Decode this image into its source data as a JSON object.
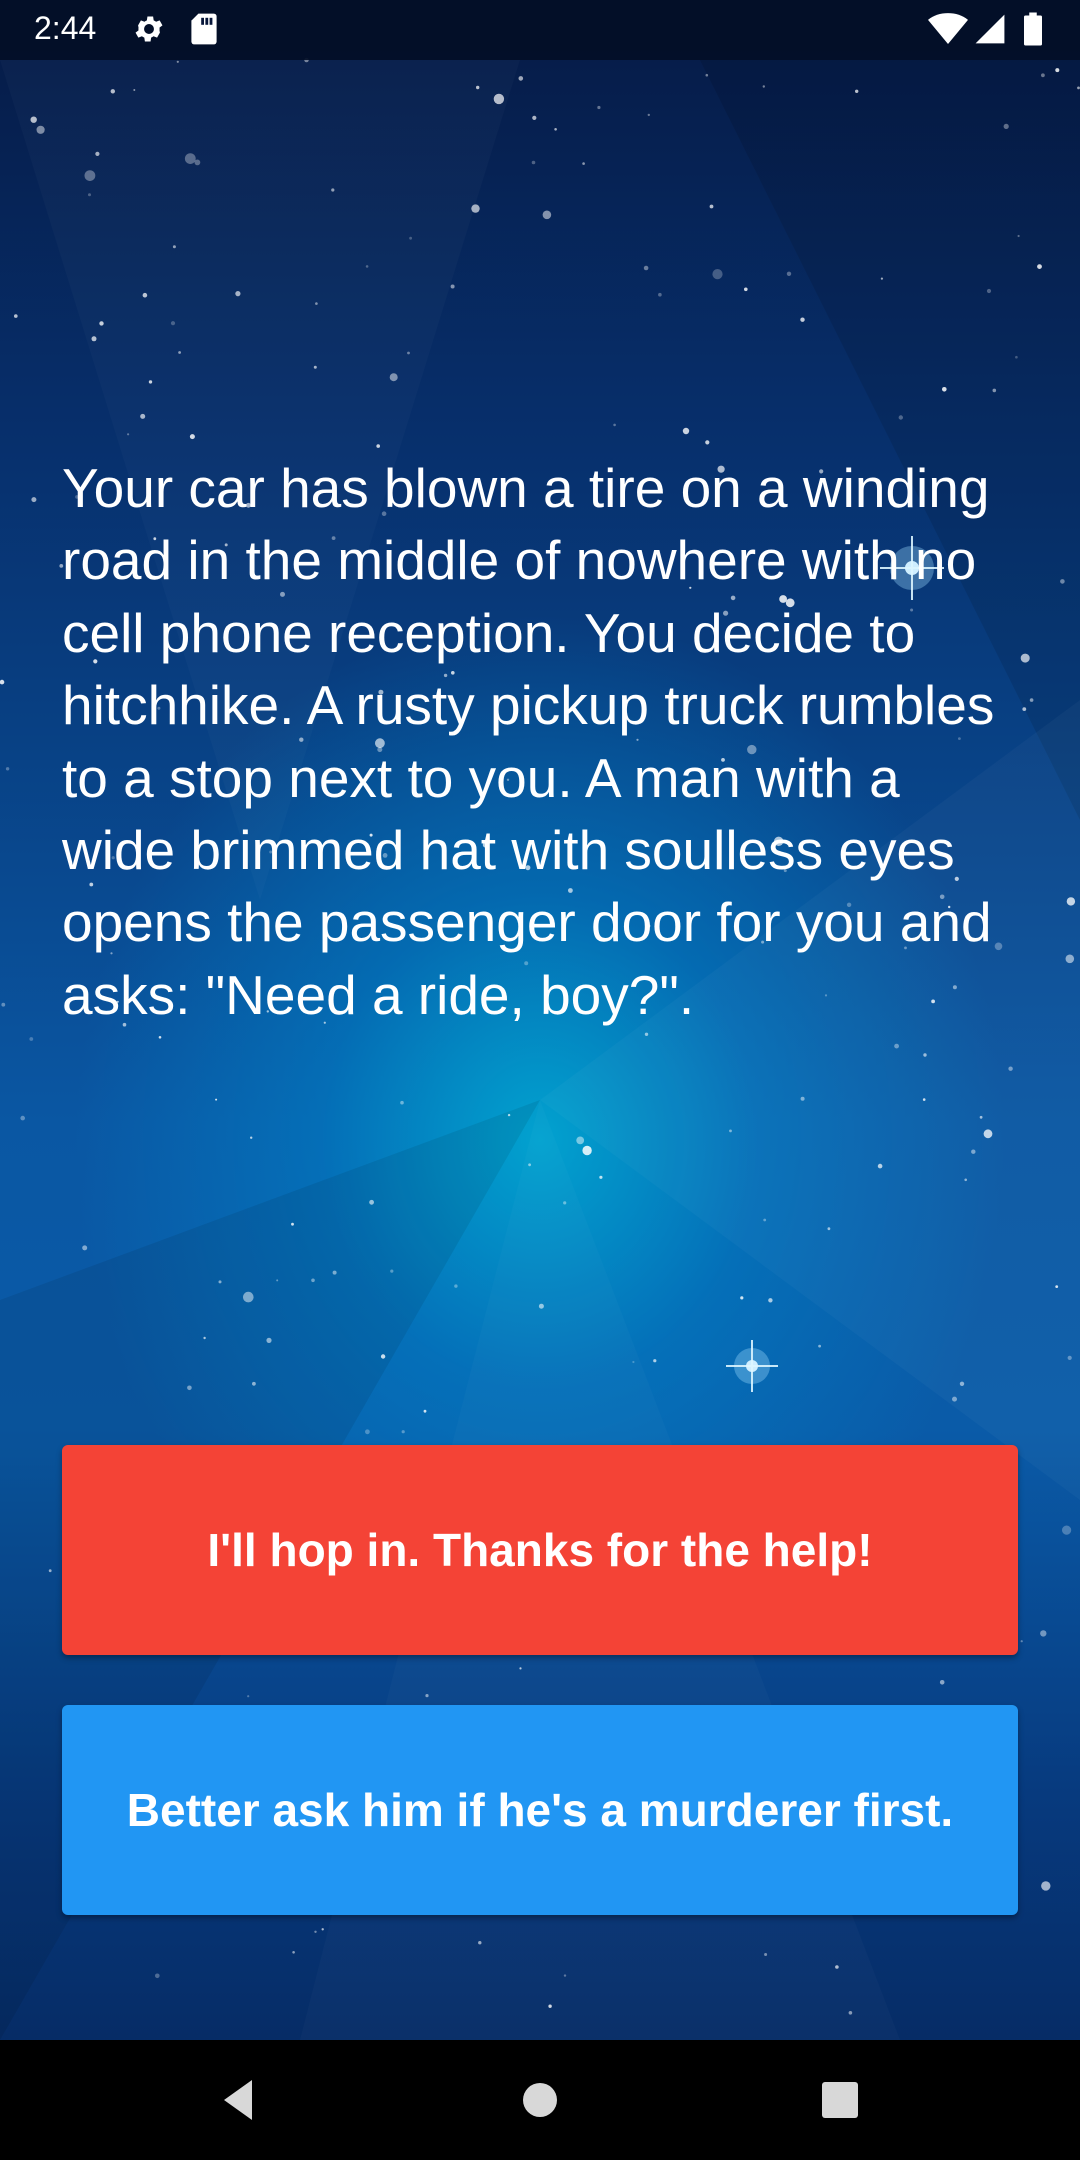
{
  "status_bar": {
    "time": "2:44",
    "icons": [
      "settings-gear-icon",
      "sd-card-icon",
      "wifi-icon",
      "cell-signal-icon",
      "battery-icon"
    ]
  },
  "story": {
    "text": "Your car has blown a tire on a winding road in the middle of nowhere with no cell phone reception. You decide to hitchhike. A rusty pickup truck rumbles to a stop next to you. A man with a wide brimmed hat with soulless eyes opens the passenger door for you and asks: \"Need a ride, boy?\"."
  },
  "choices": [
    {
      "label": "I'll hop in. Thanks for the help!",
      "color": "#f44336"
    },
    {
      "label": "Better ask him if he's a murderer first.",
      "color": "#2196f3"
    }
  ],
  "nav_bar": {
    "icons": [
      "back-triangle-icon",
      "home-circle-icon",
      "recents-square-icon"
    ]
  },
  "theme": {
    "background_top": "#061a45",
    "background_glow": "#00afd7"
  }
}
